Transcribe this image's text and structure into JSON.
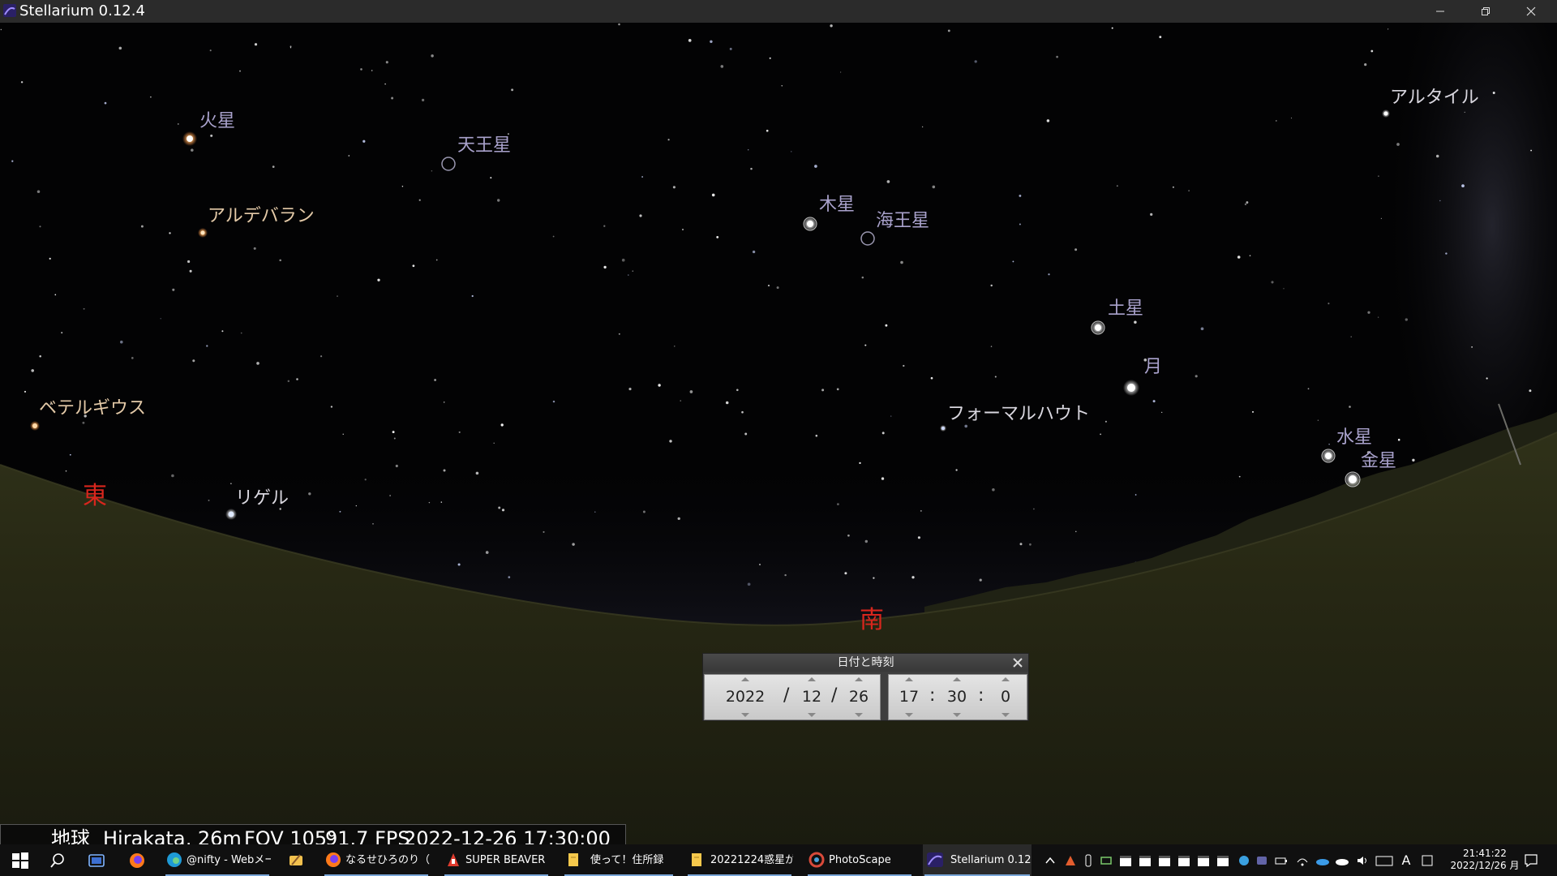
{
  "window": {
    "title": "Stellarium 0.12.4"
  },
  "sky": {
    "objects": [
      {
        "name": "火星",
        "kind": "planet"
      },
      {
        "name": "天王星",
        "kind": "planet"
      },
      {
        "name": "アルデバラン",
        "kind": "giant"
      },
      {
        "name": "木星",
        "kind": "planet"
      },
      {
        "name": "海王星",
        "kind": "planet"
      },
      {
        "name": "アルタイル",
        "kind": "star"
      },
      {
        "name": "土星",
        "kind": "planet"
      },
      {
        "name": "月",
        "kind": "planet"
      },
      {
        "name": "フォーマルハウト",
        "kind": "star"
      },
      {
        "name": "ベテルギウス",
        "kind": "giant"
      },
      {
        "name": "水星",
        "kind": "planet"
      },
      {
        "name": "金星",
        "kind": "planet"
      },
      {
        "name": "リゲル",
        "kind": "star"
      }
    ],
    "cardinals": {
      "east": "東",
      "south": "南"
    }
  },
  "datetime_dialog": {
    "title": "日付と時刻",
    "year": "2022",
    "month": "12",
    "day": "26",
    "hour": "17",
    "minute": "30",
    "second": "0",
    "date_sep": "/",
    "time_sep": ":"
  },
  "status": {
    "planet": "地球",
    "location": "Hirakata, 26m",
    "fov": "FOV 105°",
    "fps": "91.7 FPS",
    "datetime": "2022-12-26   17:30:00"
  },
  "taskbar": {
    "items": [
      {
        "label": "@nifty - Webメー...",
        "active": false
      },
      {
        "label": "なるせひろのり（@...",
        "active": false
      },
      {
        "label": "SUPER BEAVER「...",
        "active": false
      },
      {
        "label": "使って！住所録",
        "active": false
      },
      {
        "label": "20221224惑星が...",
        "active": false
      },
      {
        "label": "PhotoScape",
        "active": false
      },
      {
        "label": "Stellarium 0.12.4",
        "active": true
      }
    ],
    "tray": {
      "ime_mode": "A"
    },
    "clock": {
      "time": "21:41:22",
      "date": "2022/12/26 月"
    }
  },
  "colors": {
    "cardinal": "#d8261d",
    "planet_label": "#a9a2cc",
    "star_label": "#d9d7df",
    "giant_label": "#e4caa8",
    "taskbar_bg": "#101010"
  }
}
